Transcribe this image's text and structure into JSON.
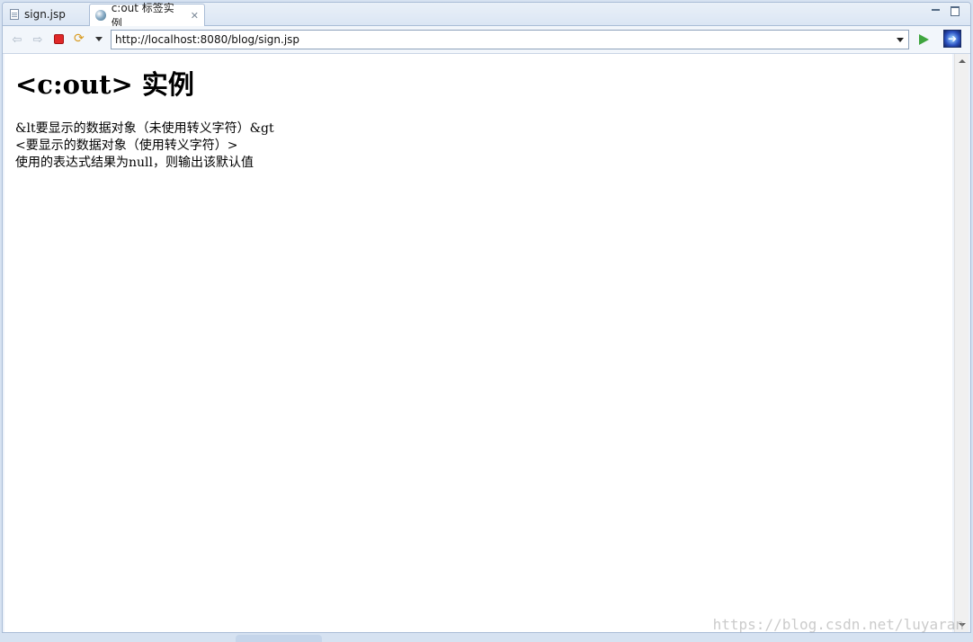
{
  "tabs": [
    {
      "label": "sign.jsp",
      "icon": "file-icon",
      "active": false
    },
    {
      "label": "c:out 标签实例",
      "icon": "globe-icon",
      "active": true,
      "close": "✕"
    }
  ],
  "toolbar": {
    "back": "⇦",
    "forward": "⇨",
    "url": "http://localhost:8080/blog/sign.jsp"
  },
  "page": {
    "heading": "<c:out> 实例",
    "lines": [
      "&lt要显示的数据对象（未使用转义字符）&gt",
      "<要显示的数据对象（使用转义字符）>",
      "使用的表达式结果为null，则输出该默认值"
    ]
  },
  "watermark": "https://blog.csdn.net/luyaran",
  "colors": {
    "accent": "#a9bcd6",
    "stop": "#e02828",
    "go": "#3fa53f"
  }
}
